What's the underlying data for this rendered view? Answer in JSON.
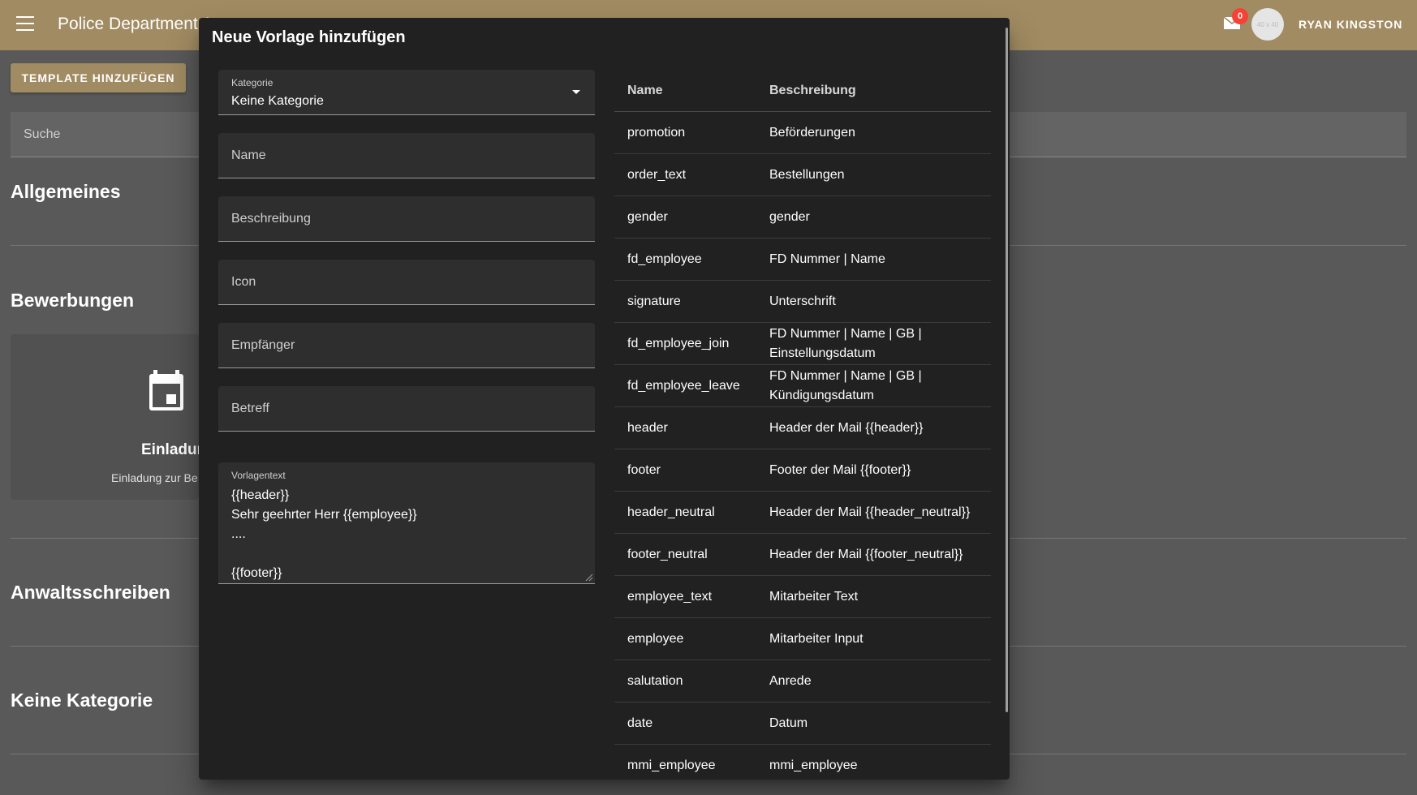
{
  "appbar": {
    "title": "Police Department A",
    "notification_count": "0",
    "avatar_placeholder": "40 x 40",
    "username": "RYAN KINGSTON"
  },
  "background": {
    "add_button": "TEMPLATE HINZUFÜGEN",
    "search_label": "Suche",
    "sections": {
      "general": "Allgemeines",
      "applications": "Bewerbungen",
      "lawyer_letters": "Anwaltsschreiben",
      "no_category": "Keine Kategorie"
    },
    "card": {
      "title": "Einladun",
      "subtitle": "Einladung zur Be",
      "icon": "calendar-icon"
    }
  },
  "dialog": {
    "title": "Neue Vorlage hinzufügen",
    "form": {
      "category_label": "Kategorie",
      "category_value": "Keine Kategorie",
      "name_label": "Name",
      "description_label": "Beschreibung",
      "icon_label": "Icon",
      "recipient_label": "Empfänger",
      "subject_label": "Betreff",
      "template_text_label": "Vorlagentext",
      "template_text_lines": [
        "{{header}}",
        "Sehr geehrter Herr {{employee}}",
        "....",
        "",
        "{{footer}}"
      ]
    },
    "variables": {
      "headers": {
        "name": "Name",
        "description": "Beschreibung"
      },
      "rows": [
        {
          "name": "promotion",
          "description": "Beförderungen"
        },
        {
          "name": "order_text",
          "description": "Bestellungen"
        },
        {
          "name": "gender",
          "description": "gender"
        },
        {
          "name": "fd_employee",
          "description": "FD Nummer | Name"
        },
        {
          "name": "signature",
          "description": "Unterschrift"
        },
        {
          "name": "fd_employee_join",
          "description": "FD Nummer | Name | GB | Einstellungsdatum"
        },
        {
          "name": "fd_employee_leave",
          "description": "FD Nummer | Name | GB | Kündigungsdatum"
        },
        {
          "name": "header",
          "description": "Header der Mail {{header}}"
        },
        {
          "name": "footer",
          "description": "Footer der Mail {{footer}}"
        },
        {
          "name": "header_neutral",
          "description": "Header der Mail {{header_neutral}}"
        },
        {
          "name": "footer_neutral",
          "description": "Header der Mail {{footer_neutral}}"
        },
        {
          "name": "employee_text",
          "description": "Mitarbeiter Text"
        },
        {
          "name": "employee",
          "description": "Mitarbeiter Input"
        },
        {
          "name": "salutation",
          "description": "Anrede"
        },
        {
          "name": "date",
          "description": "Datum"
        },
        {
          "name": "mmi_employee",
          "description": "mmi_employee"
        }
      ]
    }
  },
  "colors": {
    "appbar": "#a08b62",
    "dialog_bg": "#212121",
    "field_bg": "#2e2e2e",
    "badge": "#f44336",
    "overlay_bg": "#595959"
  }
}
